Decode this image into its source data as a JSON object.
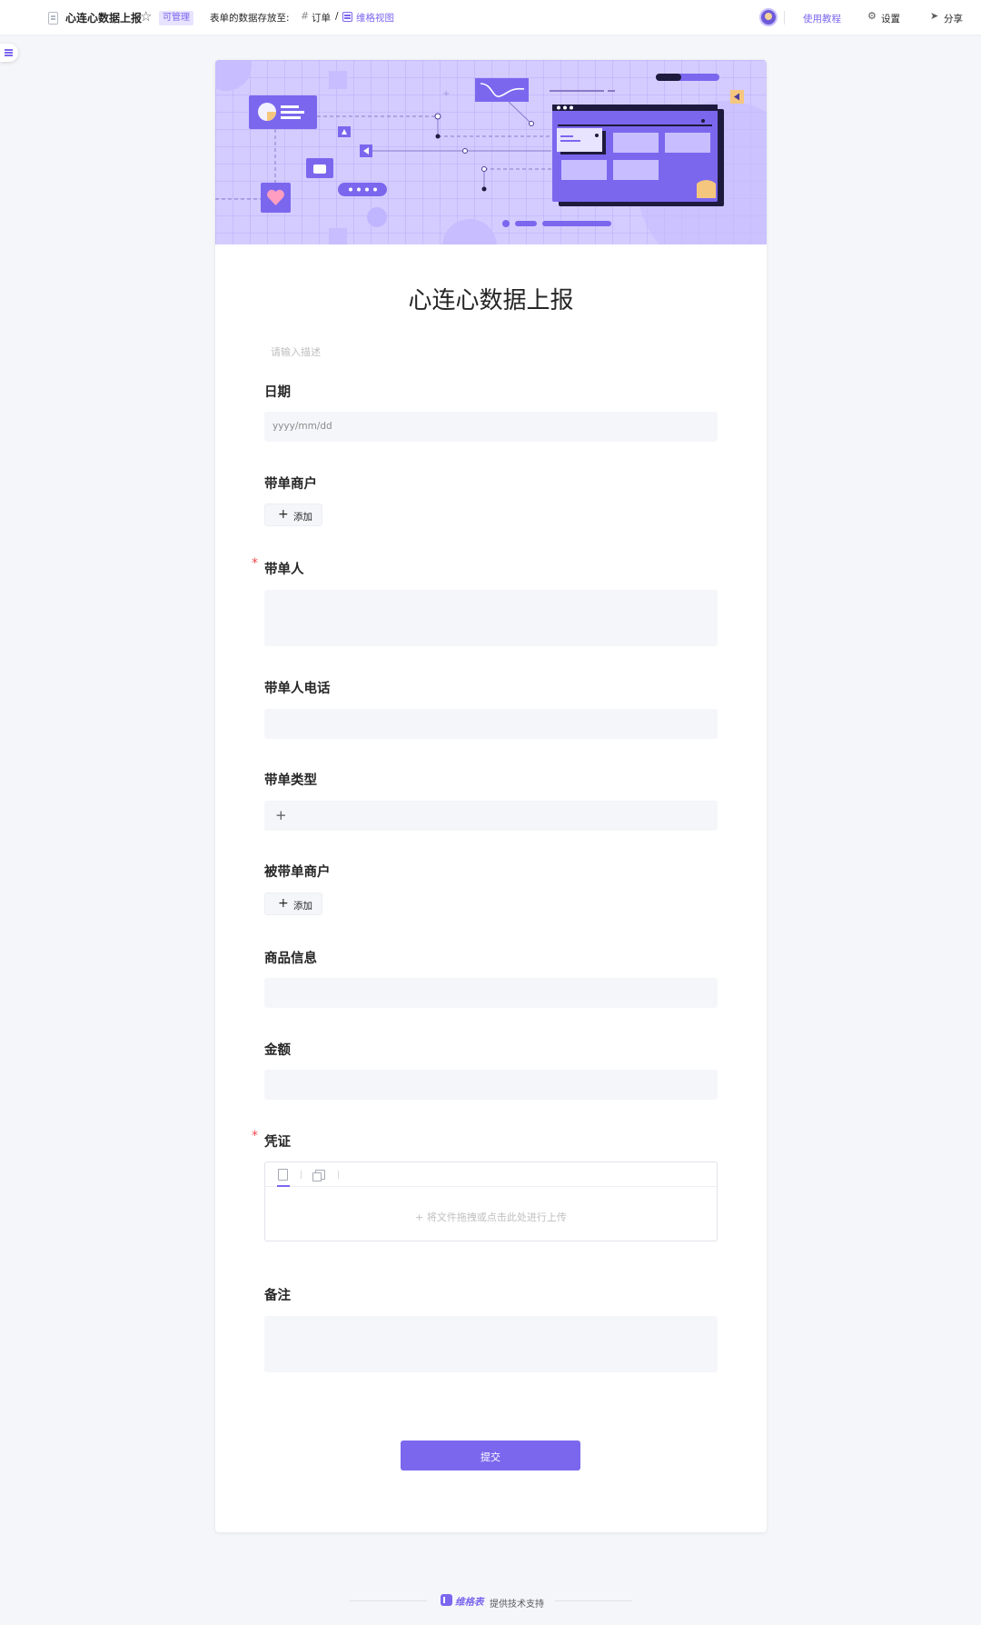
{
  "topbar": {
    "title": "心连心数据上报",
    "badge": "可管理",
    "dest_label": "表单的数据存放至:",
    "order": "订单",
    "slash": "/",
    "view": "维格视图",
    "tutorial": "使用教程",
    "settings": "设置",
    "share": "分享"
  },
  "form": {
    "title": "心连心数据上报",
    "description_placeholder": "请输入描述",
    "fields": {
      "date": {
        "label": "日期",
        "placeholder": "yyyy/mm/dd"
      },
      "merchant": {
        "label": "带单商户",
        "add": "添加"
      },
      "person": {
        "label": "带单人",
        "required": "*"
      },
      "phone": {
        "label": "带单人电话"
      },
      "type": {
        "label": "带单类型",
        "plus": "+"
      },
      "target_merchant": {
        "label": "被带单商户",
        "add": "添加"
      },
      "product": {
        "label": "商品信息"
      },
      "amount": {
        "label": "金额"
      },
      "voucher": {
        "label": "凭证",
        "required": "*",
        "upload_hint": "+ 将文件拖拽或点击此处进行上传"
      },
      "remark": {
        "label": "备注"
      }
    },
    "submit": "提交"
  },
  "footer": {
    "brand": "维格表",
    "text": "提供技术支持"
  },
  "colors": {
    "accent": "#7b67ee",
    "banner": "#d4ccff",
    "required": "#f5484f",
    "field_bg": "#f5f6fa"
  }
}
